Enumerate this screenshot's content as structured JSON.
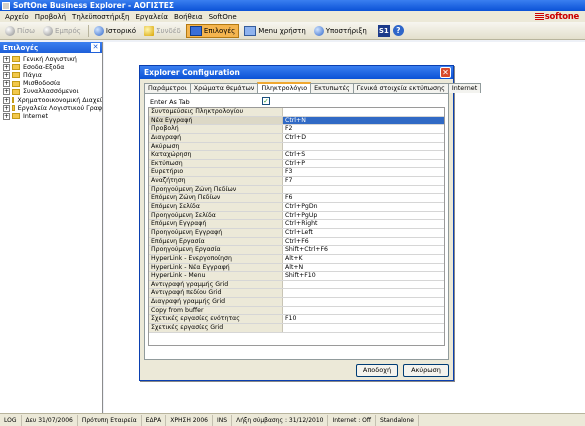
{
  "window": {
    "title": "SoftOne Business Explorer - ΑΟΓΙΣΤΕΣ"
  },
  "menubar": [
    "Αρχείο",
    "Προβολή",
    "Τηλεϋποστήριξη",
    "Εργαλεία",
    "Βοήθεια",
    "SoftOne"
  ],
  "brand": {
    "logo_text": "softone"
  },
  "toolbar": {
    "back": "Πίσω",
    "forward": "Εμπρός",
    "history": "Ιστορικό",
    "favorites": "Συνδέδ",
    "options": "Επιλογές",
    "user_menu": "Menu χρήστη",
    "support": "Υποστήριξη",
    "s1": "S1",
    "help": "?"
  },
  "leftpanel": {
    "title": "Επιλογές",
    "items": [
      "Γενική Λογιστική",
      "Εσοδα-Εξοδα",
      "Πάγια",
      "Μισθοδοσία",
      "Συναλλασσόμενοι",
      "Χρηματοοικονομική Διαχεί",
      "Εργαλεία Λογιστικού Γραφ",
      "Internet"
    ]
  },
  "dialog": {
    "title": "Explorer Configuration",
    "tabs": [
      "Παράμετροι",
      "Χρώματα θεμάτων",
      "Πληκτρολόγιο",
      "Εκτυπωτές",
      "Γενικά στοιχεία εκτύπωσης",
      "Internet"
    ],
    "active_tab": "Πληκτρολόγιο",
    "enter_as_tab_label": "Enter As Tab",
    "enter_as_tab_checked": "✓",
    "grid": {
      "header": "Συντομεύσεις Πληκτρολογίου",
      "rows": [
        [
          "Νέα Εγγραφή",
          "Ctrl+N"
        ],
        [
          "Προβολή",
          "F2"
        ],
        [
          "Διαγραφή",
          "Ctrl+D"
        ],
        [
          "Ακύρωση",
          ""
        ],
        [
          "Καταχώρηση",
          "Ctrl+S"
        ],
        [
          "Εκτύπωση",
          "Ctrl+P"
        ],
        [
          "Ευρετήριο",
          "F3"
        ],
        [
          "Αναζήτηση",
          "F7"
        ],
        [
          "Προηγούμενη Ζώνη Πεδίων",
          ""
        ],
        [
          "Επόμενη Ζώνη Πεδίων",
          "F6"
        ],
        [
          "Επόμενη Σελίδα",
          "Ctrl+PgDn"
        ],
        [
          "Προηγούμενη Σελίδα",
          "Ctrl+PgUp"
        ],
        [
          "Επόμενη Εγγραφή",
          "Ctrl+Right"
        ],
        [
          "Προηγούμενη Εγγραφή",
          "Ctrl+Left"
        ],
        [
          "Επόμενη Εργασία",
          "Ctrl+F6"
        ],
        [
          "Προηγούμενη Εργασία",
          "Shift+Ctrl+F6"
        ],
        [
          "HyperLink - Ενεργοποίηση",
          "Alt+K"
        ],
        [
          "HyperLink - Νέα Εγγραφή",
          "Alt+N"
        ],
        [
          "HyperLink - Menu",
          "Shift+F10"
        ],
        [
          "Αντιγραφή γραμμής Grid",
          ""
        ],
        [
          "Αντιγραφή πεδίου Grid",
          ""
        ],
        [
          "Διαγραφή γραμμής Grid",
          ""
        ],
        [
          "Copy from buffer",
          ""
        ],
        [
          "Σχετικές εργασίες ενότητας",
          "F10"
        ],
        [
          "Σχετικές εργασίες Grid",
          ""
        ]
      ]
    },
    "ok_label": "Αποδοχή",
    "cancel_label": "Ακύρωση"
  },
  "statusbar": [
    "LOG",
    "Δευ 31/07/2006",
    "Πρότυπη Εταιρεία",
    "ΕΔΡΑ",
    "ΧΡΗΣΗ 2006",
    "INS",
    "Λήξη σύμβασης : 31/12/2010",
    "Internet : Off",
    "Standalone"
  ]
}
